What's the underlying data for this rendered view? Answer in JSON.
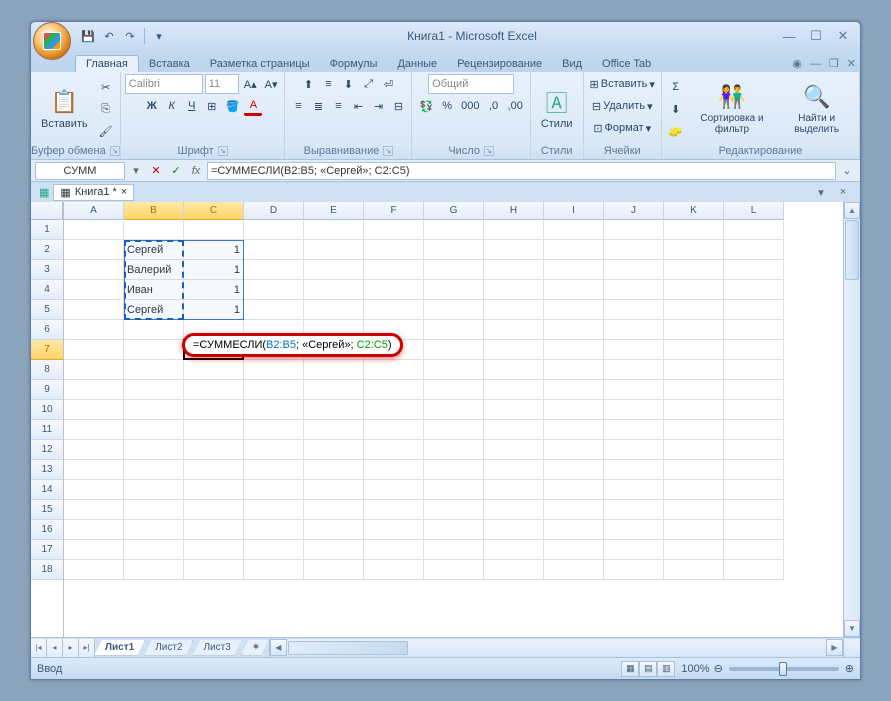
{
  "title": "Книга1 - Microsoft Excel",
  "qat": {
    "save": "💾",
    "undo": "↶",
    "redo": "↷"
  },
  "wincontrols": {
    "min": "—",
    "max": "☐",
    "close": "✕"
  },
  "tabs": [
    "Главная",
    "Вставка",
    "Разметка страницы",
    "Формулы",
    "Данные",
    "Рецензирование",
    "Вид",
    "Office Tab"
  ],
  "ribbon": {
    "clipboard": {
      "label": "Буфер обмена",
      "paste": "Вставить",
      "cut": "✂",
      "copy": "⎘",
      "painter": "🖌"
    },
    "font": {
      "label": "Шрифт",
      "name": "Calibri",
      "size": "11",
      "bold": "Ж",
      "italic": "К",
      "underline": "Ч",
      "border": "⊞",
      "fill": "🪣",
      "color": "A"
    },
    "align": {
      "label": "Выравнивание"
    },
    "number": {
      "label": "Число",
      "format": "Общий",
      "currency": "💱",
      "percent": "%",
      "thousands": "000",
      "incdec": ",0",
      "decdec": ",00"
    },
    "styles": {
      "label": "Стили",
      "btn": "Стили"
    },
    "cells": {
      "label": "Ячейки",
      "insert": "Вставить",
      "delete": "Удалить",
      "format": "Формат"
    },
    "editing": {
      "label": "Редактирование",
      "sort": "Сортировка и фильтр",
      "find": "Найти и выделить",
      "sum": "Σ",
      "fill": "⬇",
      "clear": "🧽"
    }
  },
  "formulabar": {
    "namebox": "СУММ",
    "cancel": "✕",
    "enter": "✓",
    "fx": "fx",
    "formula": "=СУММЕСЛИ(B2:B5; «Сергей»; C2:C5)"
  },
  "workbook_tab": {
    "name": "Книга1 *"
  },
  "columns": [
    "A",
    "B",
    "C",
    "D",
    "E",
    "F",
    "G",
    "H",
    "I",
    "J",
    "K",
    "L"
  ],
  "rows": [
    "1",
    "2",
    "3",
    "4",
    "5",
    "6",
    "7",
    "8",
    "9",
    "10",
    "11",
    "12",
    "13",
    "14",
    "15",
    "16",
    "17",
    "18"
  ],
  "cell_formula": {
    "prefix": "=СУММЕСЛИ(",
    "r1": "B2:B5",
    "mid": "; «Сергей»; ",
    "r2": "C2:C5",
    "suffix": ")"
  },
  "chart_data": {
    "type": "table",
    "columns": [
      "B",
      "C"
    ],
    "rows": [
      {
        "B": "Сергей",
        "C": 1
      },
      {
        "B": "Валерий",
        "C": 1
      },
      {
        "B": "Иван",
        "C": 1
      },
      {
        "B": "Сергей",
        "C": 1
      }
    ]
  },
  "sheets": [
    "Лист1",
    "Лист2",
    "Лист3"
  ],
  "status": {
    "mode": "Ввод",
    "zoom": "100%"
  }
}
